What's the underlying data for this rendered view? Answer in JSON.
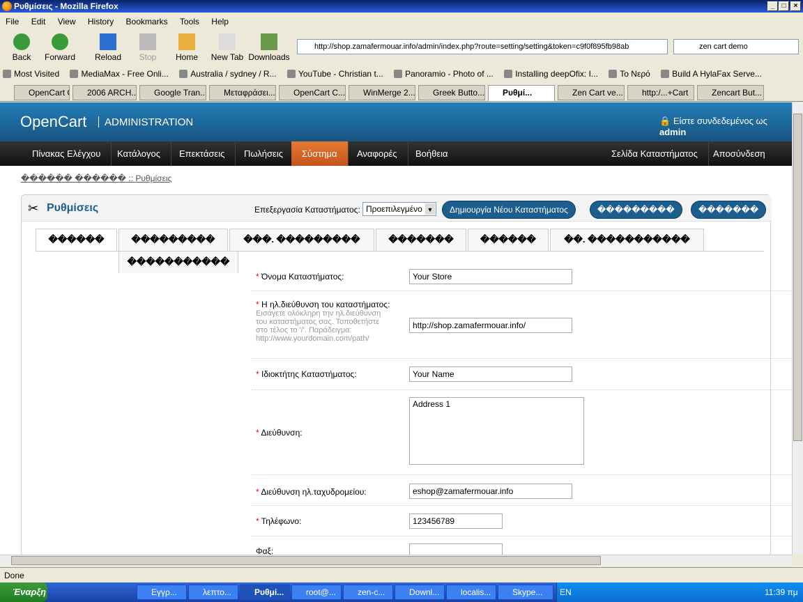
{
  "window": {
    "title": "Ρυθμίσεις - Mozilla Firefox"
  },
  "menubar": [
    "File",
    "Edit",
    "View",
    "History",
    "Bookmarks",
    "Tools",
    "Help"
  ],
  "nav": {
    "back": "Back",
    "forward": "Forward",
    "reload": "Reload",
    "stop": "Stop",
    "home": "Home",
    "newtab": "New Tab",
    "downloads": "Downloads"
  },
  "url": "http://shop.zamafermouar.info/admin/index.php?route=setting/setting&token=c9f0f895fb98ab",
  "search": "zen cart  demo",
  "bookmarks": [
    "Most Visited",
    "MediaMax - Free Onli...",
    "Australia / sydney / R...",
    "YouTube - Christian t...",
    "Panoramio - Photo of ...",
    "Installing deepOfix: I...",
    "Το Νερό",
    "Build A HylaFax Serve..."
  ],
  "tabs": [
    "OpenCart C...",
    "2006 ARCH...",
    "Google Tran...",
    "Μεταφράσει...",
    "OpenCart C...",
    "WinMerge 2...",
    "Greek Butto...",
    "Ρυθμί...",
    "Zen Cart ve...",
    "http:/...+Cart",
    "Zencart But..."
  ],
  "oc": {
    "logo": "OpenCart",
    "admin": "ADMINISTRATION",
    "login_prefix": "Είστε συνδεδεμένος ως",
    "login_user": "admin"
  },
  "menu": [
    "Πίνακας Ελέγχου",
    "Κατάλογος",
    "Επεκτάσεις",
    "Πωλήσεις",
    "Σύστημα",
    "Αναφορές",
    "Βοήθεια"
  ],
  "menu_right": [
    "Σελίδα Καταστήματος",
    "Αποσύνδεση"
  ],
  "breadcrumb": {
    "home": "������ ������",
    "sep": "::",
    "current": "Ρυθμίσεις"
  },
  "panel": {
    "title": "Ρυθμίσεις",
    "store_label": "Επεξεργασία Καταστήματος:",
    "store_value": "Προεπιλεγμένο",
    "create_store": "Δημιουργία Νέου Καταστήματος",
    "save": "���������",
    "cancel": "�������"
  },
  "form_tabs": [
    "������",
    "���������",
    "���. ���������",
    "�������",
    "������",
    "��. �����������",
    "�����������"
  ],
  "fields": [
    {
      "label": "Όνομα Καταστήματος:",
      "value": "Your Store"
    },
    {
      "label": "Η ηλ.διεύθυνση του καταστήματος:",
      "help": "Εισάγετε ολόκληρη την ηλ.διεύθυνση του καταστήματος σας. Τοποθετήστε στο τέλος το '/'. Παράδειγμα: http://www.yourdomain.com/path/",
      "value": "http://shop.zamafermouar.info/"
    },
    {
      "label": "Ιδιοκτήτης Καταστήματος:",
      "value": "Your Name"
    },
    {
      "label": "Διεύθυνση:",
      "value": "Address 1"
    },
    {
      "label": "Διεύθυνση ηλ.ταχυδρομείου:",
      "value": "eshop@zamafermouar.info"
    },
    {
      "label": "Τηλέφωνο:",
      "value": "123456789"
    },
    {
      "label": "Φαξ:",
      "value": ""
    }
  ],
  "status": "Done",
  "taskbar": {
    "start": "Έναρξη",
    "tasks": [
      "Εγγρ...",
      "λεπτο...",
      "Ρυθμί...",
      "root@...",
      "zen-c...",
      "Downl...",
      "localis...",
      "Skype..."
    ],
    "lang": "EN",
    "clock": "11:39 πμ"
  }
}
